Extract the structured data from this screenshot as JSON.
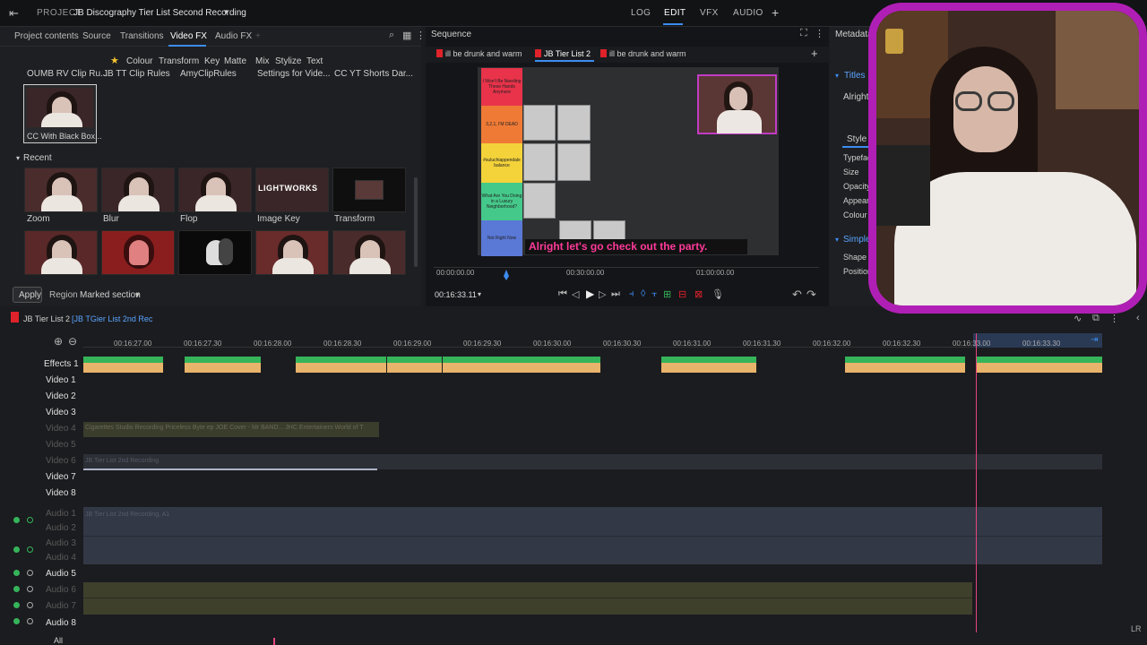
{
  "topbar": {
    "project_label": "PROJECT",
    "project_title": "JB Discography Tier List Second Recording",
    "modes": [
      "LOG",
      "EDIT",
      "VFX",
      "AUDIO"
    ],
    "active_mode": "EDIT"
  },
  "left_panel": {
    "tabs": [
      "Project contents",
      "Source",
      "Transitions",
      "Video FX",
      "Audio FX"
    ],
    "active_tab": "Video FX",
    "filters": [
      "Colour",
      "Transform",
      "Key",
      "Matte",
      "Mix",
      "Stylize",
      "Text"
    ],
    "presets": [
      "OUMB RV Clip Ru...",
      "JB TT Clip Rules",
      "AmyClipRules",
      "Settings for Vide...",
      "CC YT Shorts Dar..."
    ],
    "selected_preset": "CC With Black Box...",
    "recent_label": "Recent",
    "recent_items": [
      "Zoom",
      "Blur",
      "Flop",
      "Image Key",
      "Transform"
    ],
    "lightworks_logo": "LIGHTWORKS",
    "apply_button": "Apply",
    "region_label": "Region",
    "region_value": "Marked section"
  },
  "viewer": {
    "header": "Sequence",
    "tabs": [
      "ill be drunk and warm",
      "JB Tier List 2",
      "ill be drunk and warm"
    ],
    "active_tab": "JB Tier List 2",
    "tiers": [
      {
        "text": "I Won't Be Needing These Hands Anymore",
        "color": "#e8334a"
      },
      {
        "text": "3,2,1, I'M DEAD",
        "color": "#ef7a36"
      },
      {
        "text": "#suluchiappendale balance",
        "color": "#f3d23a"
      },
      {
        "text": "What Are You Doing in a Luxury Neighborhood?",
        "color": "#45c98a"
      },
      {
        "text": "Not Right Now",
        "color": "#5a78d6"
      }
    ],
    "caption": "Alright let's go check out the party.",
    "scrub_times": [
      "00:00:00.00",
      "00:30:00.00",
      "01:00:00.00"
    ],
    "current_time": "00:16:33.11"
  },
  "metadata": {
    "header": "Metadata",
    "titles_label": "Titles",
    "title_value": "Alright",
    "style_tab": "Style",
    "fields": [
      "Typeface",
      "Size",
      "Opacity",
      "Appear",
      "Colour"
    ],
    "simple_label": "Simple",
    "simple_fields": [
      "Shape",
      "Position"
    ]
  },
  "timeline": {
    "sequence_name": "JB Tier List 2",
    "sequence_sub": "[JB TGier List 2nd Rec",
    "ruler": [
      "00:16:27.00",
      "00:16:27.30",
      "00:16:28.00",
      "00:16:28.30",
      "00:16:29.00",
      "00:16:29.30",
      "00:16:30.00",
      "00:16:30.30",
      "00:16:31.00",
      "00:16:31.30",
      "00:16:32.00",
      "00:16:32.30",
      "00:16:33.00",
      "00:16:33.30"
    ],
    "video_tracks": [
      "Effects 1",
      "Video 1",
      "Video 2",
      "Video 3",
      "Video 4",
      "Video 5",
      "Video 6",
      "Video 7",
      "Video 8"
    ],
    "audio_tracks": [
      "Audio 1",
      "Audio 2",
      "Audio 3",
      "Audio 4",
      "Audio 5",
      "Audio 6",
      "Audio 7",
      "Audio 8"
    ],
    "all_label": "All",
    "lr_label": "LR",
    "clip_v4": "Cigarettes Studio Recording Priceless Byte ep JOE Cover - Mr BAND... JHC Entertainers World of T",
    "clip_v6": "JB Tier List 2nd Recording",
    "clip_audio": "JB Tier List 2nd Recording, A1"
  },
  "colors": {
    "accent": "#3c8cf0",
    "playhead": "#e8447c",
    "fx_green": "#35b45a",
    "fx_tan": "#e8b36a",
    "webcam_border": "#b01fb5"
  }
}
